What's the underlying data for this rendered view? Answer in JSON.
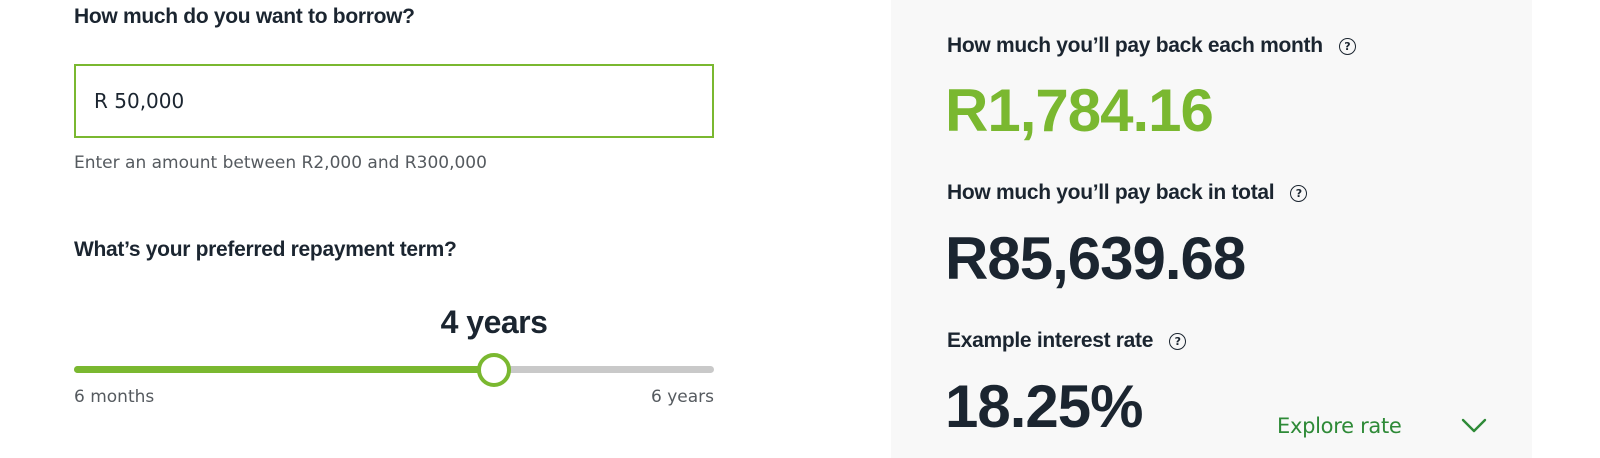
{
  "borrow": {
    "question": "How much do you want to borrow?",
    "amount_value": "R 50,000",
    "hint": "Enter an amount between R2,000 and R300,000"
  },
  "term": {
    "question": "What’s your preferred repayment term?",
    "selected_label": "4 years",
    "min_label": "6 months",
    "max_label": "6 years",
    "position_fraction": 0.657
  },
  "results": {
    "monthly_label": "How much you’ll pay back each month",
    "monthly_value": "R1,784.16",
    "total_label": "How much you’ll pay back in total",
    "total_value": "R85,639.68",
    "rate_label": "Example interest rate",
    "rate_value": "18.25%",
    "explore_label": "Explore rate"
  },
  "icons": {
    "help": "question-circle-icon",
    "expand": "chevron-down-icon"
  },
  "colors": {
    "accent_green": "#7ab830",
    "link_green": "#2e8a37",
    "text_dark": "#1b2530",
    "track_gray": "#c9c9c9",
    "panel_bg": "#f8f8f8"
  }
}
